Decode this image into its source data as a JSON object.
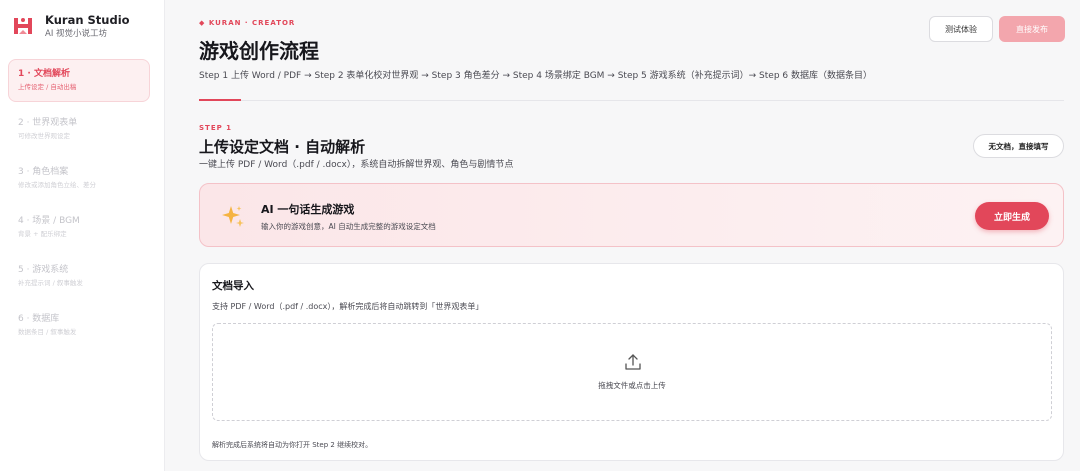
{
  "brand": {
    "name": "Kuran Studio",
    "subtitle": "AI 视觉小说工坊"
  },
  "sidebar": {
    "items": [
      {
        "title": "1 · 文档解析",
        "sub": "上传设定 / 自动出稿"
      },
      {
        "title": "2 · 世界观表单",
        "sub": "可修改世界观设定"
      },
      {
        "title": "3 · 角色档案",
        "sub": "修改或添加角色立绘、差分"
      },
      {
        "title": "4 · 场景 / BGM",
        "sub": "背景 + 配乐绑定"
      },
      {
        "title": "5 · 游戏系统",
        "sub": "补充提示词 / 叙事触发"
      },
      {
        "title": "6 · 数据库",
        "sub": "数据条目 / 叙事触发"
      }
    ]
  },
  "header": {
    "eyebrow": "◆ KURAN · CREATOR",
    "title": "游戏创作流程",
    "steps": "Step 1 上传 Word / PDF → Step 2 表单化校对世界观 → Step 3 角色差分 → Step 4 场景绑定 BGM → Step 5 游戏系统（补充提示词）→ Step 6 数据库（数据条目）",
    "test_label": "测试体验",
    "publish_label": "直接发布"
  },
  "section": {
    "step_label": "STEP 1",
    "title": "上传设定文档 · 自动解析",
    "desc": "一键上传 PDF / Word（.pdf / .docx），系统自动拆解世界观、角色与剧情节点",
    "no_doc_label": "无文档，直接填写"
  },
  "ai_card": {
    "title": "AI 一句话生成游戏",
    "desc": "输入你的游戏创意，AI 自动生成完整的游戏设定文档",
    "button_label": "立即生成"
  },
  "import_card": {
    "title": "文档导入",
    "desc": "支持 PDF / Word（.pdf / .docx），解析完成后将自动跳转到「世界观表单」",
    "drop_text": "拖拽文件或点击上传",
    "footer": "解析完成后系统将自动为你打开 Step 2 继续校对。"
  },
  "colors": {
    "accent": "#e2475a",
    "accent_light": "#f3a6ad",
    "card_bg": "#fbe6e8"
  },
  "icons": {
    "logo": "kuran-logo-icon",
    "sparkle": "sparkle-icon",
    "upload": "upload-icon"
  }
}
